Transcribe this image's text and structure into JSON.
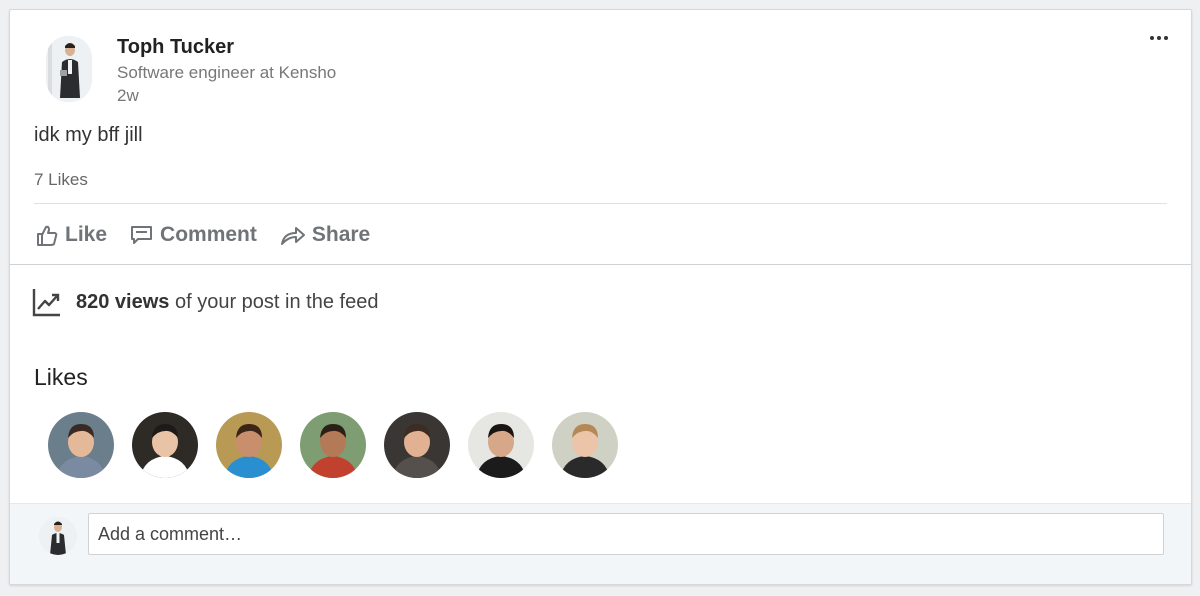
{
  "post": {
    "author": {
      "name": "Toph Tucker",
      "headline": "Software engineer at Kensho",
      "time": "2w"
    },
    "text": "idk my bff jill",
    "likes_count_text": "7 Likes"
  },
  "actions": {
    "like": "Like",
    "comment": "Comment",
    "share": "Share"
  },
  "views": {
    "count": "820 views",
    "suffix": " of your post in the feed"
  },
  "likes_section": {
    "heading": "Likes",
    "likers": [
      {
        "bg": "#6b7e8c",
        "skin": "#e4b99a",
        "hair": "#3a2a22",
        "shirt": "#7a8aa0"
      },
      {
        "bg": "#2e2a26",
        "skin": "#e8c3a6",
        "hair": "#1e1a18",
        "shirt": "#ffffff"
      },
      {
        "bg": "#b89a55",
        "skin": "#c98f6c",
        "hair": "#3b2418",
        "shirt": "#2a8fd0"
      },
      {
        "bg": "#7f9d72",
        "skin": "#b47a58",
        "hair": "#2b1f18",
        "shirt": "#c2402e"
      },
      {
        "bg": "#3a3634",
        "skin": "#e2b093",
        "hair": "#3c2c22",
        "shirt": "#55504c"
      },
      {
        "bg": "#e6e6e3",
        "skin": "#d6a889",
        "hair": "#1a1412",
        "shirt": "#1b1b1b"
      },
      {
        "bg": "#cfd1c4",
        "skin": "#ecc4a8",
        "hair": "#b58858",
        "shirt": "#2a2a2a"
      }
    ]
  },
  "comment_box": {
    "placeholder": "Add a comment…"
  },
  "colors": {
    "action_gray": "#707478",
    "divider": "#dfe2e5",
    "comment_bar_bg": "#f3f6f8"
  }
}
